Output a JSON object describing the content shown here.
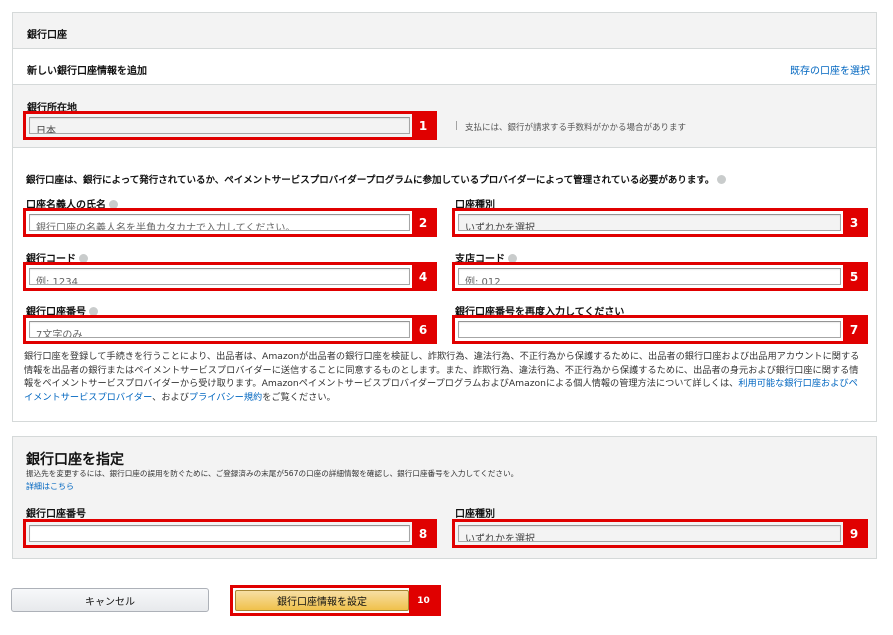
{
  "section": {
    "title": "銀行口座",
    "add_new": "新しい銀行口座情報を追加",
    "select_existing": "既存の口座を選択"
  },
  "location": {
    "label": "銀行所在地",
    "value": "日本",
    "badge": "1",
    "note_bar": "|",
    "note": "支払には、銀行が請求する手数料がかかる場合があります"
  },
  "requirement": "銀行口座は、銀行によって発行されているか、ペイメントサービスプロバイダープログラムに参加しているプロバイダーによって管理されている必要があります。",
  "holder": {
    "label": "口座名義人の氏名",
    "placeholder": "銀行口座の名義人名を半角カタカナで入力してください。",
    "badge": "2"
  },
  "type": {
    "label": "口座種別",
    "value": "いずれかを選択",
    "badge": "3"
  },
  "bank_code": {
    "label": "銀行コード",
    "placeholder": "例: 1234",
    "badge": "4"
  },
  "branch_code": {
    "label": "支店コード",
    "placeholder": "例: 012",
    "badge": "5"
  },
  "account_number": {
    "label": "銀行口座番号",
    "placeholder": "7文字のみ",
    "badge": "6"
  },
  "account_number_confirm": {
    "label": "銀行口座番号を再度入力してください",
    "value": "",
    "badge": "7"
  },
  "disclaimer": {
    "text_1": "銀行口座を登録して手続きを行うことにより、出品者は、Amazonが出品者の銀行口座を検証し、詐欺行為、違法行為、不正行為から保護するために、出品者の銀行口座および出品用アカウントに関する情報を出品者の銀行またはペイメントサービスプロバイダーに送信することに同意するものとします。また、詐欺行為、違法行為、不正行為から保護するために、出品者の身元および銀行口座に関する情報をペイメントサービスプロバイダーから受け取ります。AmazonペイメントサービスプロバイダープログラムおよびAmazonによる個人情報の管理方法について詳しくは、",
    "link_1": "利用可能な銀行口座およびペイメントサービスプロバイダー",
    "text_2": "、および",
    "link_2": "プライバシー規約",
    "text_3": "をご覧ください。"
  },
  "specify": {
    "title": "銀行口座を指定",
    "description": "振込先を変更するには、銀行口座の誤用を防ぐために、ご登録済みの末尾が567の口座の詳細情報を確認し、銀行口座番号を入力してください。",
    "details_link": "詳細はこちら",
    "account_label": "銀行口座番号",
    "account_value": "",
    "account_badge": "8",
    "type_label": "口座種別",
    "type_value": "いずれかを選択",
    "type_badge": "9"
  },
  "buttons": {
    "cancel": "キャンセル",
    "submit": "銀行口座情報を設定",
    "submit_badge": "10"
  },
  "colors": {
    "highlight": "#e00000",
    "link": "#0066c0",
    "primary_button": "#f0c14b",
    "panel_header": "#f3f3f3"
  }
}
